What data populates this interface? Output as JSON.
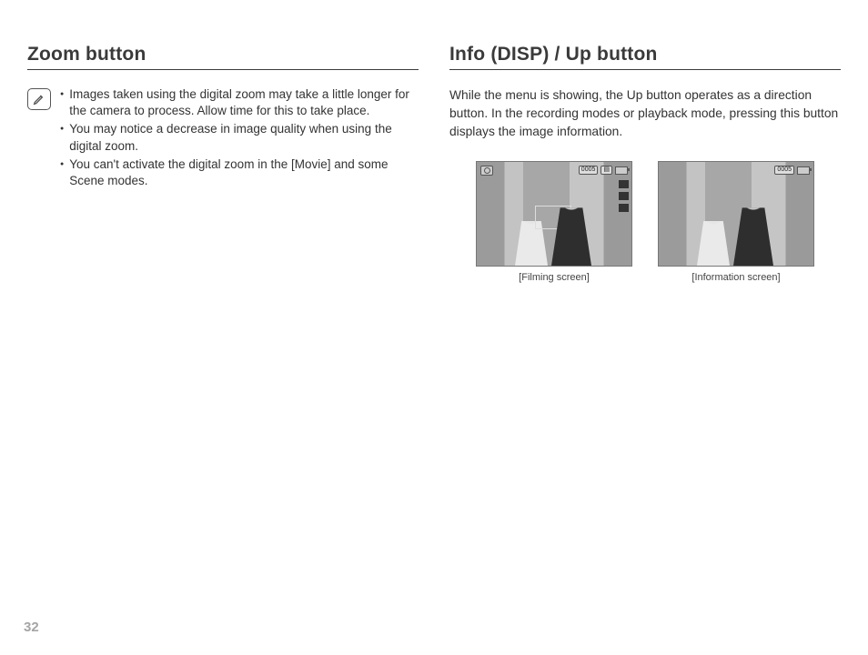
{
  "page_number": "32",
  "left": {
    "heading": "Zoom button",
    "note_icon": "note-pencil-icon",
    "bullets": [
      "Images taken using the digital zoom may take a little longer for the camera to process. Allow time for this to take place.",
      "You may notice a decrease in image quality when using the digital zoom.",
      "You can't activate the digital zoom in the [Movie] and some Scene modes."
    ]
  },
  "right": {
    "heading": "Info (DISP) / Up button",
    "intro": "While the menu is showing, the Up button operates as a direction button. In the recording modes or playback mode, pressing this button displays the image information.",
    "shots": [
      {
        "caption": "[Filming screen]",
        "osd_counter": "0005",
        "has_side_icons": true,
        "has_focus_box": true
      },
      {
        "caption": "[Information screen]",
        "osd_counter": "0005",
        "has_side_icons": false,
        "has_focus_box": false
      }
    ]
  }
}
